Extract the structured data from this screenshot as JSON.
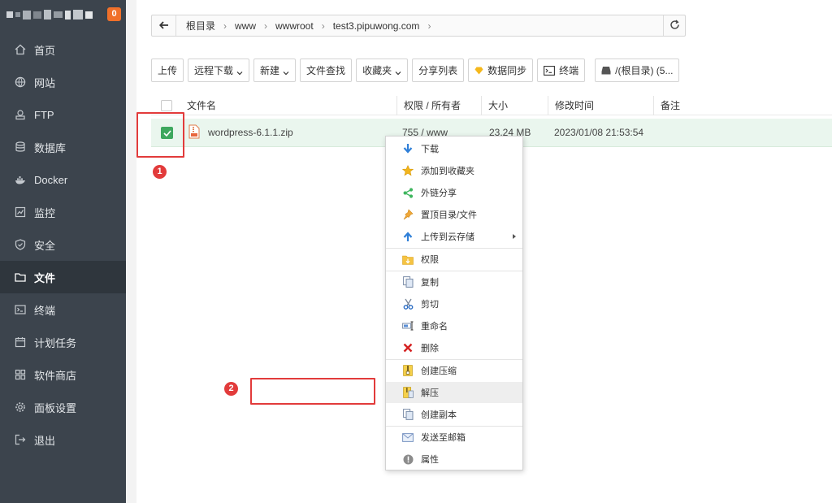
{
  "sidebar": {
    "badge": "0",
    "items": [
      {
        "label": "首页",
        "icon": "home-icon"
      },
      {
        "label": "网站",
        "icon": "globe-icon"
      },
      {
        "label": "FTP",
        "icon": "ftp-icon"
      },
      {
        "label": "数据库",
        "icon": "database-icon"
      },
      {
        "label": "Docker",
        "icon": "docker-icon"
      },
      {
        "label": "监控",
        "icon": "monitor-icon"
      },
      {
        "label": "安全",
        "icon": "shield-icon"
      },
      {
        "label": "文件",
        "icon": "folder-icon"
      },
      {
        "label": "终端",
        "icon": "terminal-icon"
      },
      {
        "label": "计划任务",
        "icon": "calendar-icon"
      },
      {
        "label": "软件商店",
        "icon": "grid-icon"
      },
      {
        "label": "面板设置",
        "icon": "gear-icon"
      },
      {
        "label": "退出",
        "icon": "logout-icon"
      }
    ],
    "active_index": 7
  },
  "address_bar": {
    "breadcrumbs": [
      "根目录",
      "www",
      "wwwroot",
      "test3.pipuwong.com"
    ]
  },
  "toolbar": {
    "upload": "上传",
    "remote_download": "远程下载",
    "new": "新建",
    "file_search": "文件查找",
    "favorites": "收藏夹",
    "share_list": "分享列表",
    "data_sync": "数据同步",
    "terminal": "终端",
    "disk": "/(根目录) (5..."
  },
  "table": {
    "headers": {
      "name": "文件名",
      "permission": "权限 / 所有者",
      "size": "大小",
      "modified": "修改时间",
      "remark": "备注"
    },
    "rows": [
      {
        "name": "wordpress-6.1.1.zip",
        "permission": "755 / www",
        "size": "23.24 MB",
        "modified": "2023/01/08 21:53:54",
        "selected": true
      }
    ]
  },
  "context_menu": {
    "items": [
      {
        "label": "下载",
        "icon": "download-icon"
      },
      {
        "label": "添加到收藏夹",
        "icon": "star-icon"
      },
      {
        "label": "外链分享",
        "icon": "share-icon"
      },
      {
        "label": "置顶目录/文件",
        "icon": "pin-icon"
      },
      {
        "label": "上传到云存储",
        "icon": "cloud-upload-icon",
        "submenu": true
      },
      {
        "label": "权限",
        "icon": "permission-folder-icon"
      },
      {
        "label": "复制",
        "icon": "copy-icon"
      },
      {
        "label": "剪切",
        "icon": "scissors-icon"
      },
      {
        "label": "重命名",
        "icon": "rename-icon"
      },
      {
        "label": "删除",
        "icon": "delete-icon"
      },
      {
        "label": "创建压缩",
        "icon": "archive-icon"
      },
      {
        "label": "解压",
        "icon": "extract-icon",
        "highlighted": true
      },
      {
        "label": "创建副本",
        "icon": "duplicate-icon"
      },
      {
        "label": "发送至邮箱",
        "icon": "mail-icon"
      },
      {
        "label": "属性",
        "icon": "info-icon"
      }
    ]
  },
  "annotations": {
    "marker1": "1",
    "marker2": "2"
  },
  "colors": {
    "sidebar_bg": "#3c444d",
    "accent_green": "#3ea85e",
    "annotation_red": "#e23b3b",
    "badge_orange": "#f0702a"
  }
}
